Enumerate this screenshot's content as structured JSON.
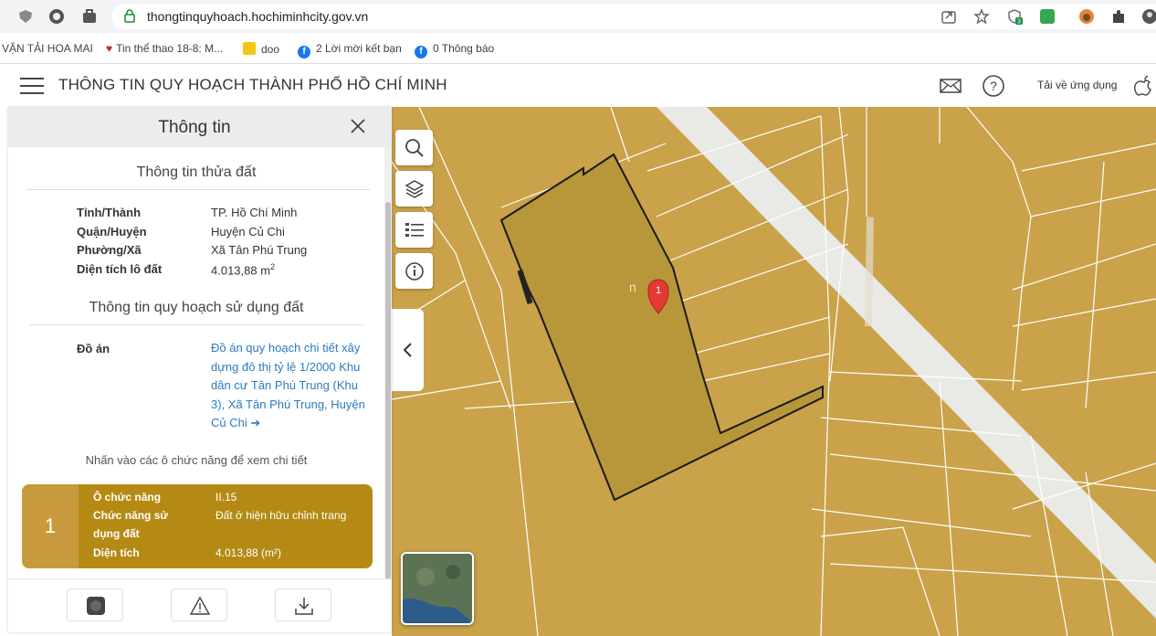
{
  "browser": {
    "url": "thongtinquyhoach.hochiminhcity.gov.vn",
    "extension_badge": "3",
    "bookmarks": [
      {
        "label": "VẬN TẢI HOA MAI"
      },
      {
        "label": "Tin thể thao 18-8: M..."
      },
      {
        "label": "doo"
      },
      {
        "label": "2 Lời mời kết bạn"
      },
      {
        "label": "0 Thông báo"
      }
    ]
  },
  "header": {
    "title": "THÔNG TIN QUY HOẠCH THÀNH PHỐ HỒ CHÍ MINH",
    "download_app": "Tải về ứng dụng"
  },
  "panel": {
    "title": "Thông tin",
    "parcel_section_title": "Thông tin thửa đất",
    "parcel": [
      {
        "label": "Tỉnh/Thành",
        "value": "TP. Hồ Chí Minh"
      },
      {
        "label": "Quận/Huyện",
        "value": "Huyện Củ Chi"
      },
      {
        "label": "Phường/Xã",
        "value": "Xã Tân Phú Trung"
      },
      {
        "label": "Diện tích lô đất",
        "value": "4.013,88 m",
        "unit_sup": "2"
      }
    ],
    "planning_section_title": "Thông tin quy hoạch sử dụng đất",
    "project_label": "Đồ án",
    "project_link": "Đồ án quy hoạch chi tiết xây dựng đô thị tỷ lệ 1/2000 Khu dân cư Tân Phú Trung (Khu 3), Xã Tân Phú Trung, Huyện Củ Chi",
    "project_arrow": "➔",
    "hint": "Nhấn vào các ô chức năng để xem chi tiết",
    "function_card": {
      "number": "1",
      "rows": [
        {
          "label": "Ô chức năng",
          "value": "II.15"
        },
        {
          "label": "Chức năng sử dụng đất",
          "value": "Đất ở hiện hữu chỉnh trang"
        },
        {
          "label": "Diện tích",
          "value": "4.013,88 (m²)"
        }
      ]
    }
  },
  "map": {
    "marker_label": "1",
    "watermark_fragment": "n",
    "land_color": "#c9a24a",
    "selected_parcel_color": "#b8963a",
    "road_color": "#e9e9e6"
  }
}
